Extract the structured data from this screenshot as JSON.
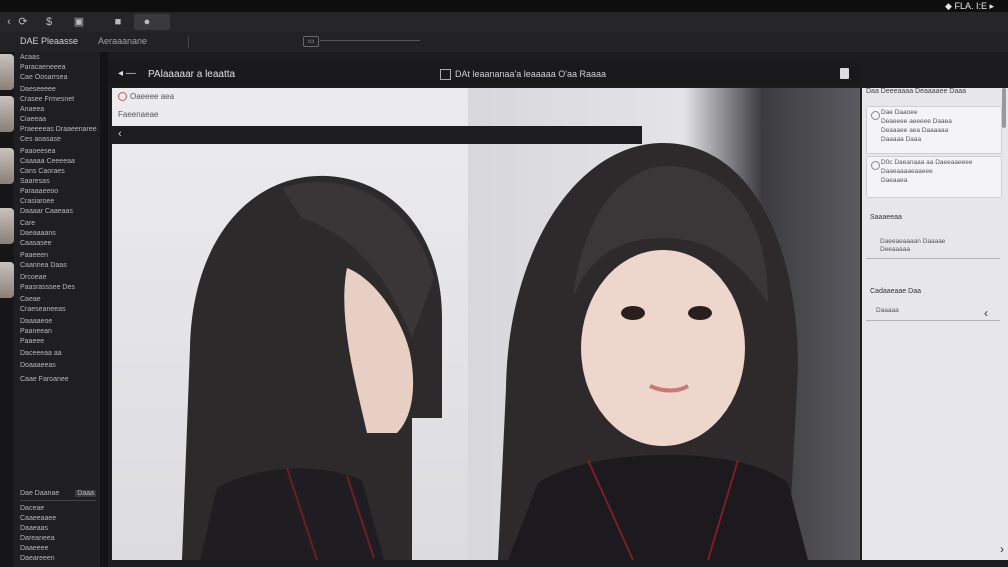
{
  "topbar": {
    "status": "◆ FLA. I:E ▸"
  },
  "toolbar": {
    "icons": [
      "back-icon",
      "refresh-icon",
      "dollar-icon",
      "window-icon",
      "stop-icon",
      "message-icon"
    ]
  },
  "tabs": {
    "first": "DAE Pleaasse",
    "second": "Aeraaanane"
  },
  "mini_button": "▭",
  "sidebar": {
    "items": [
      "Acaas",
      "Paracaeneeea",
      "Cae Oosarrsea",
      "Daeseeeee",
      "Crasee Frmesnet",
      "Anaeea",
      "Ciaeeaa",
      "Praeeeeas Draaeenaree",
      "Ces aoasase",
      "Paaoeesea",
      "Caaaaa Ceeeeaa",
      "Cans Caoraes",
      "Saaresas",
      "Paraaaeeoo",
      "Crasiaroee",
      "Daaaar Caaeaas",
      "Care",
      "Daeaaaans",
      "Caasasee",
      "Paaeeen",
      "Caannea Daas",
      "Drcoeae",
      "Paasrasssee Des",
      "Caeae",
      "Craeseaneeas",
      "Daaaaeoe",
      "Paaneean",
      "Paaeee",
      "Daceeeaa aa",
      "Doaaaeeas",
      "Caae Faroanee"
    ],
    "footer_header": "Dae Daanae",
    "footer_badge": "Daaa",
    "footer_items": [
      "Daceae",
      "Caaeeaaee",
      "Daaeaas",
      "Dareaneea",
      "Daaeeee",
      "Daeareeen"
    ]
  },
  "main": {
    "back_label": "◂ —",
    "title": "PAlaaaaar a leaatta",
    "subtitle": "DAt leaananaa'a leaaaaa O'aa Raaaa"
  },
  "canvas_overlay": {
    "row1": "Oaeeee aea",
    "row2": "Faeenaeae",
    "back_glyph": "‹"
  },
  "right_panel": {
    "header": "Daa Deeeaaaa Deaaaaee Daaa",
    "card1": [
      "Dae Daaoee",
      "Deaeeee aeeeee Daaea",
      "Deaaaee aea Daaaaaa",
      "Daaaaa Daaa"
    ],
    "card2": [
      "D0c Daeanaaa aa Daeeaaeeee",
      "Daaeaaaaeaaeee",
      "Daeaaea"
    ],
    "label1": "Saaaeeaa",
    "field1": [
      "Daeeaeaaaan Daaaae",
      "Deeaaaaa"
    ],
    "label2": "Cadaaeaae Daa",
    "field2": "Daaaaa",
    "chevron": "‹",
    "next": "›"
  }
}
